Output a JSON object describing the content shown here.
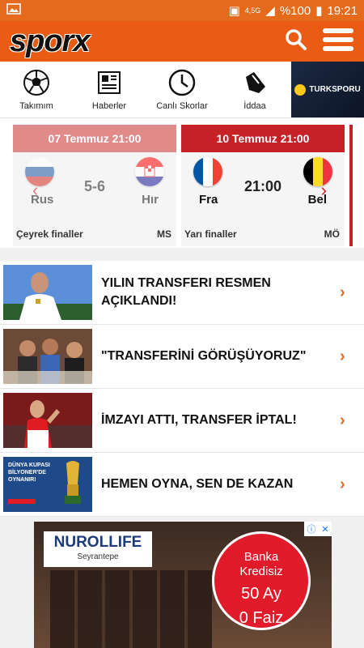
{
  "status": {
    "battery": "%100",
    "time": "19:21",
    "network": "4,5G"
  },
  "header": {
    "logo": "sporx"
  },
  "nav": [
    {
      "label": "Takımım"
    },
    {
      "label": "Haberler"
    },
    {
      "label": "Canlı Skorlar"
    },
    {
      "label": "İddaa"
    }
  ],
  "nav_ad": {
    "label": "TURKSPORU"
  },
  "matches": [
    {
      "date": "07 Temmuz 21:00",
      "home": "Rus",
      "away": "Hır",
      "score": "5-6",
      "stage": "Çeyrek finaller",
      "status": "MS"
    },
    {
      "date": "10 Temmuz 21:00",
      "home": "Fra",
      "away": "Bel",
      "score": "21:00",
      "stage": "Yarı finaller",
      "status": "MÖ"
    }
  ],
  "news": [
    {
      "title": "YILIN TRANSFERI RESMEN AÇIKLANDI!"
    },
    {
      "title": "\"TRANSFERİNİ GÖRÜŞÜYORUZ\""
    },
    {
      "title": "İMZAYI ATTI, TRANSFER İPTAL!"
    },
    {
      "title": "HEMEN OYNA, SEN DE KAZAN"
    }
  ],
  "news_promo": {
    "line1": "DÜNYA KUPASI",
    "line2": "BİLYONER'DE",
    "line3": "OYNANIR!"
  },
  "ad": {
    "brand": "NUROLLIFE",
    "brand_sub": "Seyrantepe",
    "line1": "Banka",
    "line2": "Kredisiz",
    "line3": "50 Ay",
    "line4": "0 Faiz"
  }
}
